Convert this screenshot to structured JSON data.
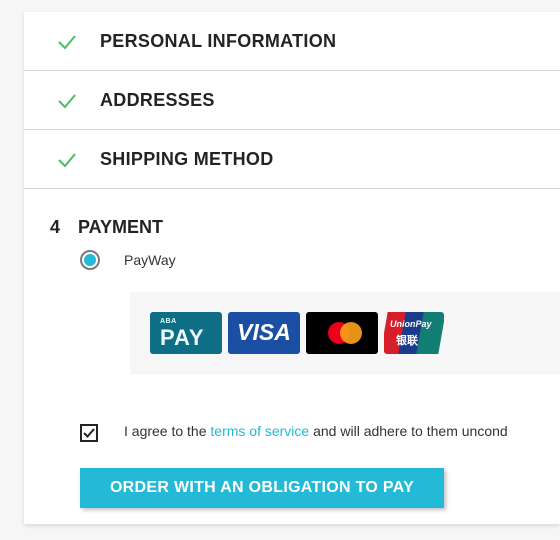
{
  "steps": [
    {
      "label": "PERSONAL INFORMATION",
      "icon": "check-icon"
    },
    {
      "label": "ADDRESSES",
      "icon": "check-icon"
    },
    {
      "label": "SHIPPING METHOD",
      "icon": "check-icon"
    }
  ],
  "payment": {
    "number": "4",
    "title": "PAYMENT",
    "option_label": "PayWay",
    "option_selected": true,
    "logos": {
      "aba_small": "ABA",
      "aba_big": "PAY",
      "visa": "VISA",
      "unionpay_top": "UnionPay",
      "unionpay_bottom": "银联"
    }
  },
  "terms": {
    "checked": true,
    "prefix": "I agree to the",
    "link": "terms of service",
    "suffix": "and will adhere to them uncond"
  },
  "order_button": "ORDER WITH AN OBLIGATION TO PAY",
  "colors": {
    "accent": "#24b9d7",
    "check": "#4cbb6c"
  }
}
